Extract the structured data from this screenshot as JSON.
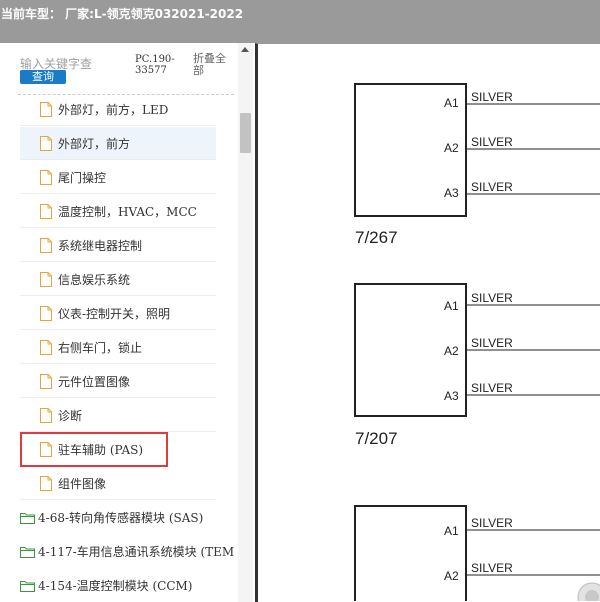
{
  "window": {
    "title": "当前车型：  厂家:L-领克领克032021-2022"
  },
  "search": {
    "placeholder": "输入关键字查",
    "button_label": "查询"
  },
  "pc_code": "PC.190-33577",
  "collapse_all_label": "折叠全部",
  "tree": {
    "leaf_items": [
      {
        "label": "外部灯，前方，LED"
      },
      {
        "label": "外部灯，前方"
      },
      {
        "label": "尾门操控"
      },
      {
        "label": "温度控制，HVAC，MCC"
      },
      {
        "label": "系统继电器控制"
      },
      {
        "label": "信息娱乐系统"
      },
      {
        "label": "仪表-控制开关，照明"
      },
      {
        "label": "右侧车门，锁止"
      },
      {
        "label": "元件位置图像"
      },
      {
        "label": "诊断"
      },
      {
        "label": "驻车辅助 (PAS)"
      },
      {
        "label": "组件图像"
      }
    ],
    "folder_items": [
      {
        "label": "4-68-转向角传感器模块 (SAS)"
      },
      {
        "label": "4-117-车用信息通讯系统模块 (TEM"
      },
      {
        "label": "4-154-温度控制模块 (CCM)"
      }
    ]
  },
  "diagram": {
    "connectors": [
      {
        "id": "7/267",
        "pins": [
          {
            "pin": "A1",
            "wire": "SILVER"
          },
          {
            "pin": "A2",
            "wire": "SILVER"
          },
          {
            "pin": "A3",
            "wire": "SILVER"
          }
        ]
      },
      {
        "id": "7/207",
        "pins": [
          {
            "pin": "A1",
            "wire": "SILVER"
          },
          {
            "pin": "A2",
            "wire": "SILVER"
          },
          {
            "pin": "A3",
            "wire": "SILVER"
          }
        ]
      },
      {
        "id": "",
        "pins": [
          {
            "pin": "A1",
            "wire": "SILVER"
          },
          {
            "pin": "A2",
            "wire": "SILVER"
          }
        ]
      }
    ]
  },
  "colors": {
    "titlebar": "#9a9a9a",
    "query_button": "#1a7bc6",
    "highlight_box": "#e0393e",
    "file_icon": "#e8a33c",
    "folder_icon": "#3a9a3a"
  }
}
